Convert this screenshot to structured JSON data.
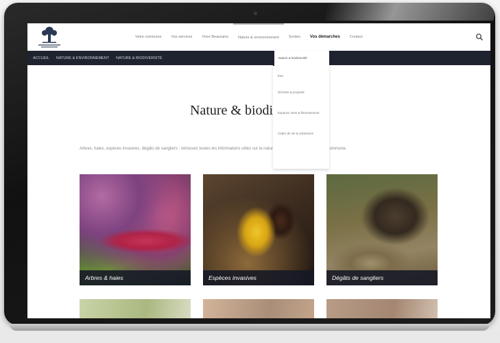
{
  "header": {
    "nav": [
      "Votre commune",
      "Vos services",
      "Vivre Beaurains",
      "Nature & environnement",
      "Sorties",
      "Vos démarches",
      "Contact"
    ],
    "search_icon": "search-icon"
  },
  "breadcrumb": [
    "Accueil",
    "Nature & environnement",
    "Nature & biodiversité"
  ],
  "dropdown": [
    "Nature & biodiversité",
    "Eau",
    "Déchets & propreté",
    "Espaces verts & fleurissement",
    "Cadre de vie & urbanisme"
  ],
  "page": {
    "title": "Nature & biodiversité",
    "intro": "Arbres, haies, espèces invasives, dégâts de sangliers : retrouvez toutes les informations utiles sur la nature et la biodiversité dans votre commune."
  },
  "cards": [
    {
      "label": "Arbres & haies"
    },
    {
      "label": "Espèces invasives"
    },
    {
      "label": "Dégâts de sangliers"
    }
  ],
  "colors": {
    "nav_dark": "#1f2330",
    "card_label_bg": "#141826"
  }
}
